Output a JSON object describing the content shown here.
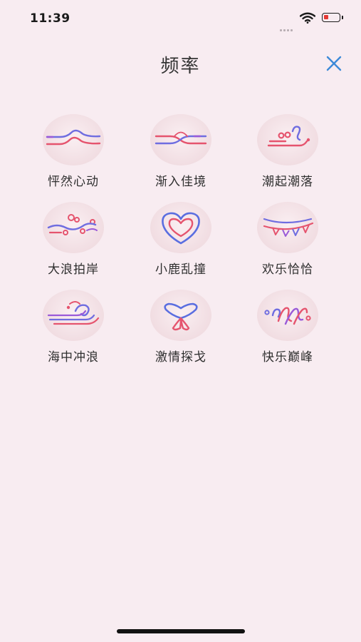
{
  "status_bar": {
    "time": "11:39",
    "battery_color": "#e53935"
  },
  "header": {
    "title": "频率",
    "close_icon": "close-icon",
    "accent": "#3d8ad8"
  },
  "modes": [
    {
      "label": "怦然心动",
      "icon": "wave-heartbeat-icon"
    },
    {
      "label": "渐入佳境",
      "icon": "wave-crossing-icon"
    },
    {
      "label": "潮起潮落",
      "icon": "wave-curl-icon"
    },
    {
      "label": "大浪拍岸",
      "icon": "wave-bubbles-icon"
    },
    {
      "label": "小鹿乱撞",
      "icon": "heart-icon"
    },
    {
      "label": "欢乐恰恰",
      "icon": "bunting-flags-icon"
    },
    {
      "label": "海中冲浪",
      "icon": "surf-wave-icon"
    },
    {
      "label": "激情探戈",
      "icon": "tango-loop-icon"
    },
    {
      "label": "快乐巅峰",
      "icon": "peak-waves-icon"
    }
  ],
  "colors": {
    "pink": "#e5546e",
    "blue": "#6f6de0",
    "purple": "#9a5ad8"
  }
}
